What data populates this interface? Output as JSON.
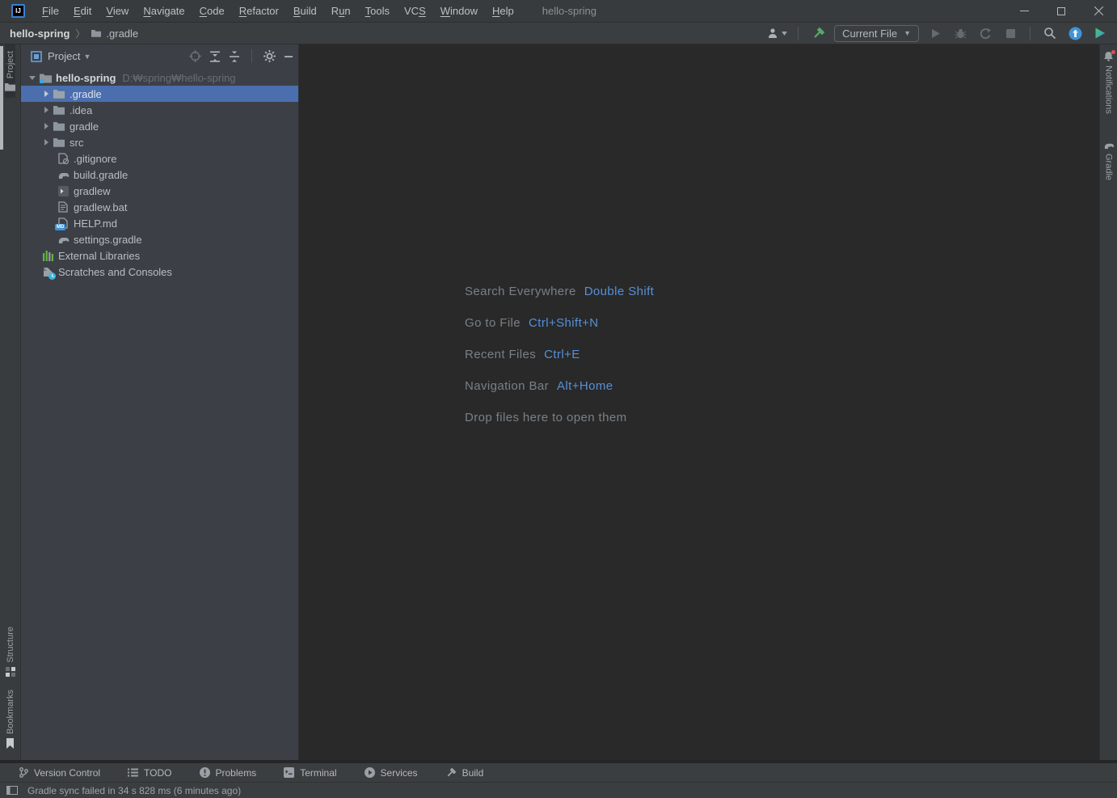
{
  "window": {
    "title": "hello-spring",
    "minimize": "—",
    "maximize": "▢",
    "close": "✕"
  },
  "menubar": {
    "items": [
      {
        "pre": "",
        "m": "F",
        "post": "ile"
      },
      {
        "pre": "",
        "m": "E",
        "post": "dit"
      },
      {
        "pre": "",
        "m": "V",
        "post": "iew"
      },
      {
        "pre": "",
        "m": "N",
        "post": "avigate"
      },
      {
        "pre": "",
        "m": "C",
        "post": "ode"
      },
      {
        "pre": "",
        "m": "R",
        "post": "efactor"
      },
      {
        "pre": "",
        "m": "B",
        "post": "uild"
      },
      {
        "pre": "R",
        "m": "u",
        "post": "n"
      },
      {
        "pre": "",
        "m": "T",
        "post": "ools"
      },
      {
        "pre": "VC",
        "m": "S",
        "post": ""
      },
      {
        "pre": "",
        "m": "W",
        "post": "indow"
      },
      {
        "pre": "",
        "m": "H",
        "post": "elp"
      }
    ]
  },
  "breadcrumb": {
    "project": "hello-spring",
    "separator": "〉",
    "item": ".gradle"
  },
  "toolbar": {
    "run_config": "Current File"
  },
  "project_panel": {
    "title": "Project",
    "rows": [
      {
        "label": "hello-spring",
        "path": "D:₩spring₩hello-spring"
      },
      {
        "label": ".gradle"
      },
      {
        "label": ".idea"
      },
      {
        "label": "gradle"
      },
      {
        "label": "src"
      },
      {
        "label": ".gitignore"
      },
      {
        "label": "build.gradle"
      },
      {
        "label": "gradlew"
      },
      {
        "label": "gradlew.bat"
      },
      {
        "label": "HELP.md"
      },
      {
        "label": "settings.gradle"
      },
      {
        "label": "External Libraries"
      },
      {
        "label": "Scratches and Consoles"
      }
    ],
    "md_badge": "MD"
  },
  "hints": {
    "items": [
      {
        "label": "Search Everywhere",
        "key": "Double Shift"
      },
      {
        "label": "Go to File",
        "key": "Ctrl+Shift+N"
      },
      {
        "label": "Recent Files",
        "key": "Ctrl+E"
      },
      {
        "label": "Navigation Bar",
        "key": "Alt+Home"
      }
    ],
    "drop_text": "Drop files here to open them"
  },
  "left_stripe": {
    "project": "Project",
    "structure": "Structure",
    "bookmarks": "Bookmarks"
  },
  "right_stripe": {
    "notifications": "Notifications",
    "gradle": "Gradle"
  },
  "toolwindow_bar": {
    "items": [
      {
        "label": "Version Control"
      },
      {
        "label": "TODO"
      },
      {
        "label": "Problems"
      },
      {
        "label": "Terminal"
      },
      {
        "label": "Services"
      },
      {
        "label": "Build"
      }
    ]
  },
  "statusbar": {
    "message": "Gradle sync failed in 34 s 828 ms (6 minutes ago)"
  },
  "colors": {
    "selection": "#4b6eaf",
    "shortcut_key_blue": "#5591d8",
    "hammer_green": "#59a869",
    "update_blue": "#3d94d8",
    "md_badge_blue": "#3d94d8",
    "panel_bg": "#3c4046",
    "editor_bg": "#292929"
  }
}
